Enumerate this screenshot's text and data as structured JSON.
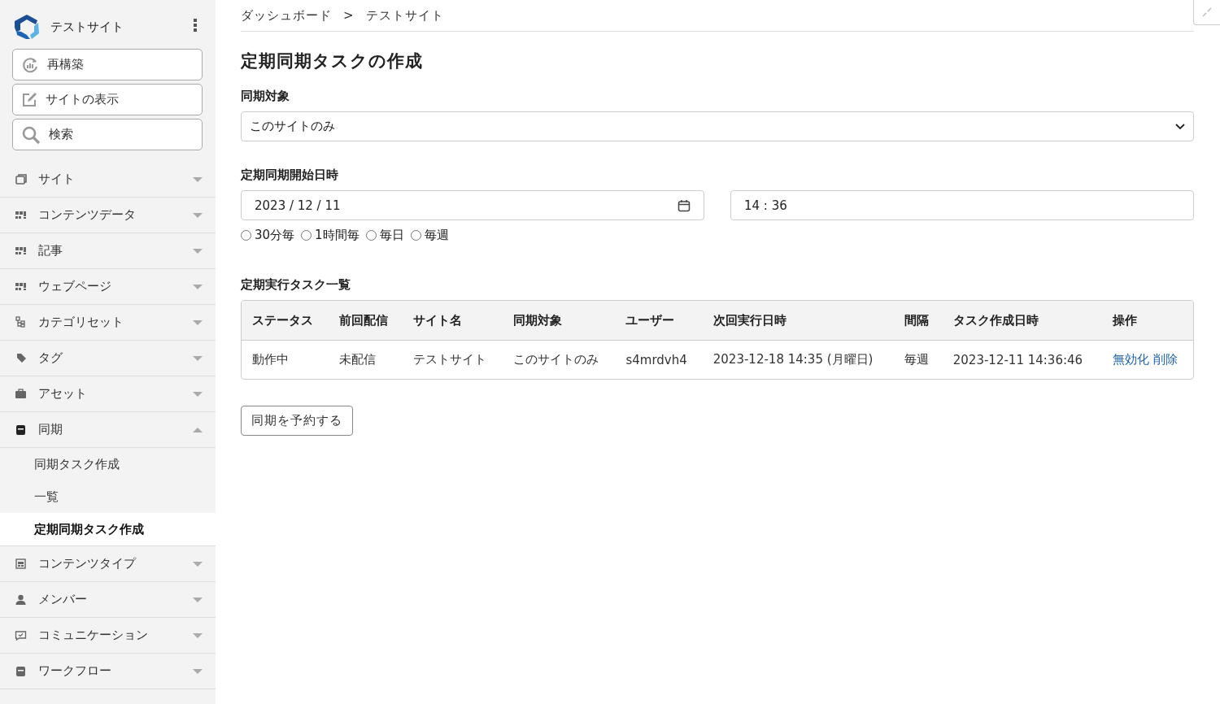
{
  "sidebar": {
    "site_name": "テストサイト",
    "buttons": [
      {
        "label": "再構築"
      },
      {
        "label": "サイトの表示"
      },
      {
        "label": "検索"
      }
    ],
    "items": [
      {
        "label": "サイト",
        "expanded": false
      },
      {
        "label": "コンテンツデータ",
        "expanded": false
      },
      {
        "label": "記事",
        "expanded": false
      },
      {
        "label": "ウェブページ",
        "expanded": false
      },
      {
        "label": "カテゴリセット",
        "expanded": false
      },
      {
        "label": "タグ",
        "expanded": false
      },
      {
        "label": "アセット",
        "expanded": false
      },
      {
        "label": "同期",
        "expanded": true,
        "children": [
          {
            "label": "同期タスク作成",
            "selected": false
          },
          {
            "label": "一覧",
            "selected": false
          },
          {
            "label": "定期同期タスク作成",
            "selected": true
          }
        ]
      },
      {
        "label": "コンテンツタイプ",
        "expanded": false
      },
      {
        "label": "メンバー",
        "expanded": false
      },
      {
        "label": "コミュニケーション",
        "expanded": false
      },
      {
        "label": "ワークフロー",
        "expanded": false
      }
    ]
  },
  "breadcrumb": [
    "ダッシュボード",
    "テストサイト"
  ],
  "breadcrumb_separator": ">",
  "title": "定期同期タスクの作成",
  "target": {
    "label": "同期対象",
    "value": "このサイトのみ"
  },
  "start": {
    "label": "定期同期開始日時",
    "date": "2023 / 12 / 11",
    "time": "14 : 36",
    "intervals": [
      {
        "label": "30分毎",
        "selected": false
      },
      {
        "label": "1時間毎",
        "selected": false
      },
      {
        "label": "毎日",
        "selected": false
      },
      {
        "label": "毎週",
        "selected": false
      }
    ]
  },
  "table": {
    "title": "定期実行タスク一覧",
    "columns": [
      "ステータス",
      "前回配信",
      "サイト名",
      "同期対象",
      "ユーザー",
      "次回実行日時",
      "間隔",
      "タスク作成日時",
      "操作"
    ],
    "rows": [
      {
        "cells": [
          "動作中",
          "未配信",
          "テストサイト",
          "このサイトのみ",
          "s4mrdvh4",
          "2023-12-18 14:35 (月曜日)",
          "毎週",
          "2023-12-11 14:36:46"
        ],
        "actions": [
          "無効化",
          "削除"
        ]
      }
    ]
  },
  "submit": "同期を予約する"
}
